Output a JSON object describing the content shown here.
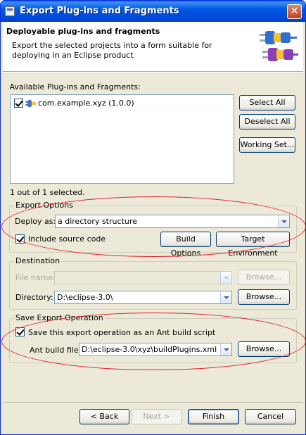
{
  "window": {
    "title": "Export Plug-ins and Fragments"
  },
  "header": {
    "title": "Deployable plug-ins and fragments",
    "description": "Export the selected projects into a form suitable for deploying in an Eclipse product"
  },
  "available": {
    "label": "Available Plug-ins and Fragments:",
    "items": [
      {
        "label": "com.example.xyz (1.0.0)",
        "checked": true
      }
    ],
    "status": "1 out of 1 selected.",
    "buttons": {
      "select_all": "Select All",
      "deselect_all": "Deselect All",
      "working_set": "Working Set..."
    }
  },
  "export_options": {
    "legend": "Export Options",
    "deploy_label": "Deploy as:",
    "deploy_value": "a directory structure",
    "include_source_label": "Include source code",
    "include_source_checked": true,
    "build_options": "Build Options",
    "target_environment": "Target Environment"
  },
  "destination": {
    "legend": "Destination",
    "file_name_label": "File name:",
    "file_name_value": "",
    "directory_label": "Directory:",
    "directory_value": "D:\\eclipse-3.0\\",
    "browse": "Browse..."
  },
  "save_export": {
    "legend": "Save Export Operation",
    "save_label": "Save this export operation as an Ant build script",
    "save_checked": true,
    "ant_file_label": "Ant build file:",
    "ant_file_value": "D:\\eclipse-3.0\\xyz\\buildPlugins.xml",
    "browse": "Browse..."
  },
  "footer": {
    "back": "< Back",
    "next": "Next >",
    "finish": "Finish",
    "cancel": "Cancel"
  },
  "colors": {
    "titlebar": "#0054e3",
    "dialog_bg": "#ece9d8",
    "annotation": "#e0202a"
  }
}
